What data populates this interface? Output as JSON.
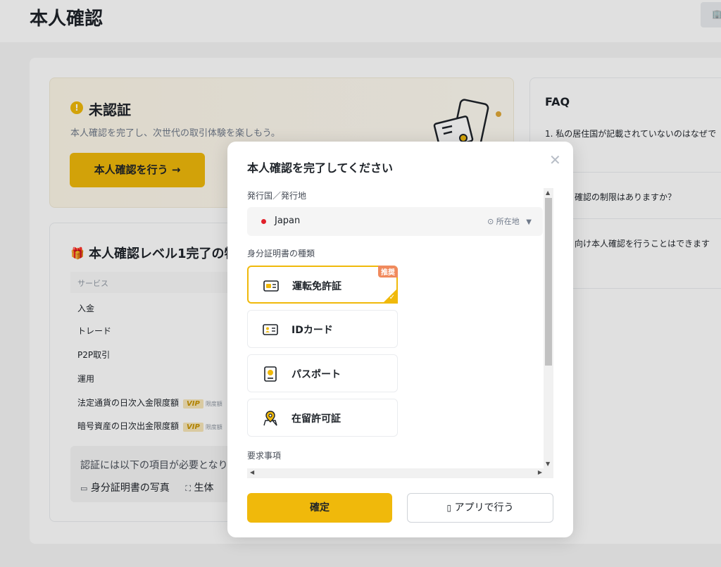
{
  "header": {
    "title": "本人確認",
    "right_button_icon": "building-icon",
    "right_button_label": "🏢"
  },
  "status_card": {
    "status_title": "未認証",
    "subtitle": "本人確認を完了し、次世代の取引体験を楽しもう。",
    "verify_button": "本人確認を行う →"
  },
  "benefits": {
    "title": "本人確認レベル1完了の特",
    "service_header": "サービス",
    "rows": [
      {
        "label": "入金"
      },
      {
        "label": "トレード"
      },
      {
        "label": "P2P取引"
      },
      {
        "label": "運用"
      },
      {
        "label": "法定通貨の日次入金限度額",
        "vip": "VIP",
        "note": "限度額"
      },
      {
        "label": "暗号資産の日次出金限度額",
        "vip": "VIP",
        "note": "限度額"
      }
    ],
    "requirement_text": "認証には以下の項目が必要となり",
    "requirement_id": "身分証明書の写真",
    "requirement_bio": "生体"
  },
  "faq": {
    "title": "FAQ",
    "questions": [
      "1. 私の居住国が記載されていないのはなぜで",
      "確認の制限はありますか？",
      "向け本人確認を行うことはできます"
    ]
  },
  "modal": {
    "title": "本人確認を完了してください",
    "issuer_label": "発行国／発行地",
    "country": "Japan",
    "location_hint": "所在地",
    "id_type_label": "身分証明書の種類",
    "id_options": [
      {
        "label": "運転免許証",
        "icon": "drivers-license-icon",
        "badge": "推奨",
        "selected": true
      },
      {
        "label": "IDカード",
        "icon": "id-card-icon",
        "selected": false
      },
      {
        "label": "パスポート",
        "icon": "passport-icon",
        "selected": false
      },
      {
        "label": "在留許可証",
        "icon": "residence-permit-icon",
        "selected": false
      }
    ],
    "requirements_label": "要求事項",
    "confirm_button": "確定",
    "app_button": "アプリで行う"
  },
  "colors": {
    "accent": "#f0b90b",
    "badge": "#f08a5d",
    "flag_red": "#e1202a"
  }
}
